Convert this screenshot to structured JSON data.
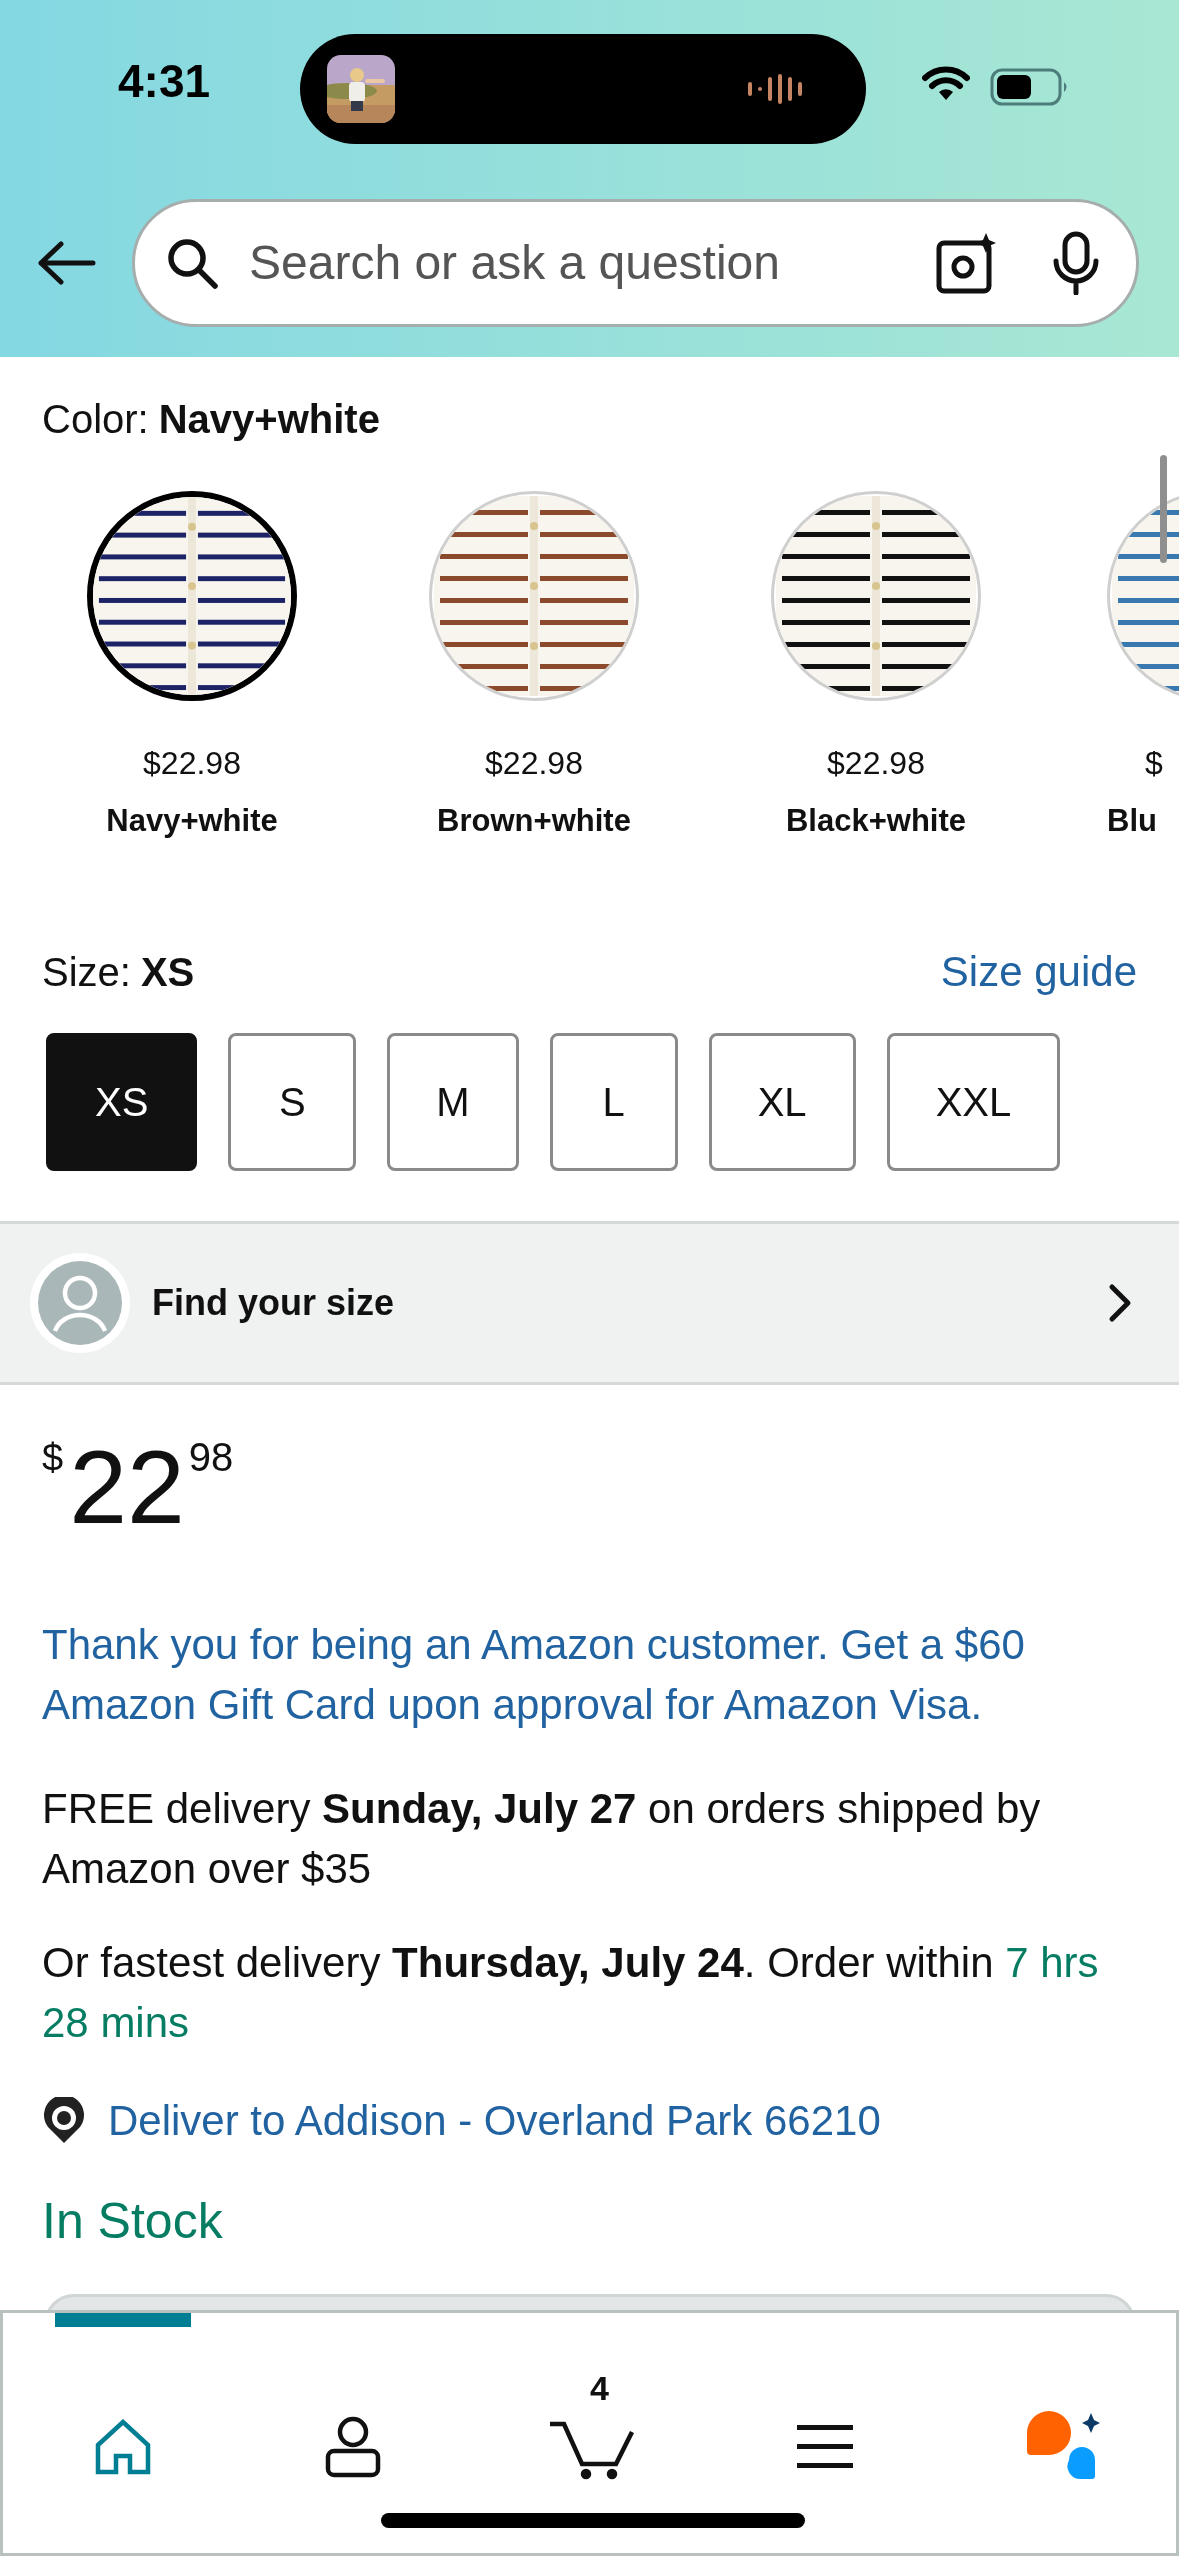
{
  "status_bar": {
    "time": "4:31"
  },
  "search": {
    "placeholder": "Search or ask a question"
  },
  "color_selector": {
    "label": "Color:",
    "value": "Navy+white",
    "swatches": [
      {
        "kind": "full",
        "price": "$22.98",
        "name": "Navy+white",
        "color": "#1c2366",
        "selected": true
      },
      {
        "kind": "full",
        "price": "$22.98",
        "name": "Brown+white",
        "color": "#8a4a2b",
        "selected": false
      },
      {
        "kind": "full",
        "price": "$22.98",
        "name": "Black+white",
        "color": "#111111",
        "selected": false
      },
      {
        "kind": "partial",
        "price": "$",
        "name": "Blu",
        "color": "#3a78b0",
        "selected": false
      }
    ]
  },
  "size_selector": {
    "label": "Size:",
    "value": "XS",
    "guide_link": "Size guide",
    "sizes": [
      {
        "label": "XS",
        "selected": true
      },
      {
        "label": "S",
        "selected": false
      },
      {
        "label": "M",
        "selected": false
      },
      {
        "label": "L",
        "selected": false
      },
      {
        "label": "XL",
        "selected": false
      },
      {
        "label": "XXL",
        "selected": false
      }
    ]
  },
  "find_size": {
    "label": "Find your size"
  },
  "price": {
    "currency": "$",
    "whole": "22",
    "fraction": "98"
  },
  "promo": "Thank you for being an Amazon customer. Get a $60 Amazon Gift Card upon approval for Amazon Visa.",
  "free_delivery": "FREE delivery **Sunday, July 27** on orders shipped by Amazon over $35",
  "fastest_delivery": {
    "text": "Or fastest delivery **Thursday, July 24**. Order within",
    "countdown": "7 hrs 28 mins"
  },
  "deliver_to": "Deliver to Addison - Overland Park 66210",
  "stock": "In Stock",
  "bottom_nav": [
    {
      "kind": "home",
      "selected": true
    },
    {
      "kind": "account",
      "selected": false
    },
    {
      "kind": "cart",
      "selected": false,
      "badge": "4"
    },
    {
      "kind": "menu",
      "selected": false
    },
    {
      "kind": "assistant",
      "selected": false
    }
  ]
}
